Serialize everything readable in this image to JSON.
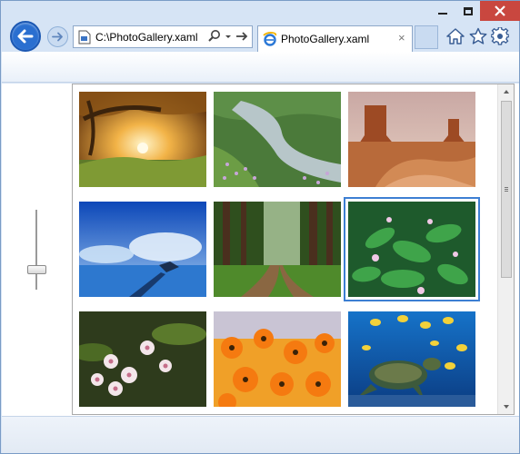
{
  "browser": {
    "address": "C:\\PhotoGallery.xaml",
    "tab_title": "PhotoGallery.xaml",
    "tab_close_glyph": "×"
  },
  "gallery": {
    "slider_level": 0.3,
    "selected_index": 5,
    "photos": [
      {
        "name": "autumn-tree-sunset"
      },
      {
        "name": "mountain-stream-meadow"
      },
      {
        "name": "desert-buttes"
      },
      {
        "name": "pier-blue-sky"
      },
      {
        "name": "forest-path"
      },
      {
        "name": "green-plants-flowers"
      },
      {
        "name": "frangipani-flowers"
      },
      {
        "name": "orange-flowers"
      },
      {
        "name": "sea-turtle-fish"
      }
    ]
  },
  "colors": {
    "chrome": "#d6e4f5",
    "close_button": "#c9473f",
    "back_button": "#2a6fd0",
    "selection": "#3d7fd3"
  }
}
